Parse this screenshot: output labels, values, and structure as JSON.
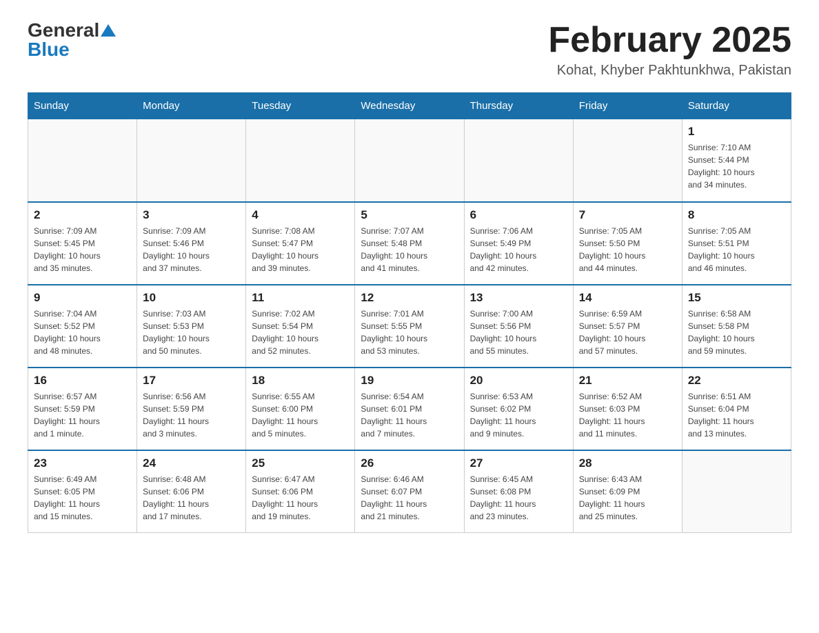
{
  "header": {
    "logo_general": "General",
    "logo_blue": "Blue",
    "month_title": "February 2025",
    "location": "Kohat, Khyber Pakhtunkhwa, Pakistan"
  },
  "weekdays": [
    "Sunday",
    "Monday",
    "Tuesday",
    "Wednesday",
    "Thursday",
    "Friday",
    "Saturday"
  ],
  "weeks": [
    [
      {
        "day": "",
        "info": ""
      },
      {
        "day": "",
        "info": ""
      },
      {
        "day": "",
        "info": ""
      },
      {
        "day": "",
        "info": ""
      },
      {
        "day": "",
        "info": ""
      },
      {
        "day": "",
        "info": ""
      },
      {
        "day": "1",
        "info": "Sunrise: 7:10 AM\nSunset: 5:44 PM\nDaylight: 10 hours\nand 34 minutes."
      }
    ],
    [
      {
        "day": "2",
        "info": "Sunrise: 7:09 AM\nSunset: 5:45 PM\nDaylight: 10 hours\nand 35 minutes."
      },
      {
        "day": "3",
        "info": "Sunrise: 7:09 AM\nSunset: 5:46 PM\nDaylight: 10 hours\nand 37 minutes."
      },
      {
        "day": "4",
        "info": "Sunrise: 7:08 AM\nSunset: 5:47 PM\nDaylight: 10 hours\nand 39 minutes."
      },
      {
        "day": "5",
        "info": "Sunrise: 7:07 AM\nSunset: 5:48 PM\nDaylight: 10 hours\nand 41 minutes."
      },
      {
        "day": "6",
        "info": "Sunrise: 7:06 AM\nSunset: 5:49 PM\nDaylight: 10 hours\nand 42 minutes."
      },
      {
        "day": "7",
        "info": "Sunrise: 7:05 AM\nSunset: 5:50 PM\nDaylight: 10 hours\nand 44 minutes."
      },
      {
        "day": "8",
        "info": "Sunrise: 7:05 AM\nSunset: 5:51 PM\nDaylight: 10 hours\nand 46 minutes."
      }
    ],
    [
      {
        "day": "9",
        "info": "Sunrise: 7:04 AM\nSunset: 5:52 PM\nDaylight: 10 hours\nand 48 minutes."
      },
      {
        "day": "10",
        "info": "Sunrise: 7:03 AM\nSunset: 5:53 PM\nDaylight: 10 hours\nand 50 minutes."
      },
      {
        "day": "11",
        "info": "Sunrise: 7:02 AM\nSunset: 5:54 PM\nDaylight: 10 hours\nand 52 minutes."
      },
      {
        "day": "12",
        "info": "Sunrise: 7:01 AM\nSunset: 5:55 PM\nDaylight: 10 hours\nand 53 minutes."
      },
      {
        "day": "13",
        "info": "Sunrise: 7:00 AM\nSunset: 5:56 PM\nDaylight: 10 hours\nand 55 minutes."
      },
      {
        "day": "14",
        "info": "Sunrise: 6:59 AM\nSunset: 5:57 PM\nDaylight: 10 hours\nand 57 minutes."
      },
      {
        "day": "15",
        "info": "Sunrise: 6:58 AM\nSunset: 5:58 PM\nDaylight: 10 hours\nand 59 minutes."
      }
    ],
    [
      {
        "day": "16",
        "info": "Sunrise: 6:57 AM\nSunset: 5:59 PM\nDaylight: 11 hours\nand 1 minute."
      },
      {
        "day": "17",
        "info": "Sunrise: 6:56 AM\nSunset: 5:59 PM\nDaylight: 11 hours\nand 3 minutes."
      },
      {
        "day": "18",
        "info": "Sunrise: 6:55 AM\nSunset: 6:00 PM\nDaylight: 11 hours\nand 5 minutes."
      },
      {
        "day": "19",
        "info": "Sunrise: 6:54 AM\nSunset: 6:01 PM\nDaylight: 11 hours\nand 7 minutes."
      },
      {
        "day": "20",
        "info": "Sunrise: 6:53 AM\nSunset: 6:02 PM\nDaylight: 11 hours\nand 9 minutes."
      },
      {
        "day": "21",
        "info": "Sunrise: 6:52 AM\nSunset: 6:03 PM\nDaylight: 11 hours\nand 11 minutes."
      },
      {
        "day": "22",
        "info": "Sunrise: 6:51 AM\nSunset: 6:04 PM\nDaylight: 11 hours\nand 13 minutes."
      }
    ],
    [
      {
        "day": "23",
        "info": "Sunrise: 6:49 AM\nSunset: 6:05 PM\nDaylight: 11 hours\nand 15 minutes."
      },
      {
        "day": "24",
        "info": "Sunrise: 6:48 AM\nSunset: 6:06 PM\nDaylight: 11 hours\nand 17 minutes."
      },
      {
        "day": "25",
        "info": "Sunrise: 6:47 AM\nSunset: 6:06 PM\nDaylight: 11 hours\nand 19 minutes."
      },
      {
        "day": "26",
        "info": "Sunrise: 6:46 AM\nSunset: 6:07 PM\nDaylight: 11 hours\nand 21 minutes."
      },
      {
        "day": "27",
        "info": "Sunrise: 6:45 AM\nSunset: 6:08 PM\nDaylight: 11 hours\nand 23 minutes."
      },
      {
        "day": "28",
        "info": "Sunrise: 6:43 AM\nSunset: 6:09 PM\nDaylight: 11 hours\nand 25 minutes."
      },
      {
        "day": "",
        "info": ""
      }
    ]
  ]
}
